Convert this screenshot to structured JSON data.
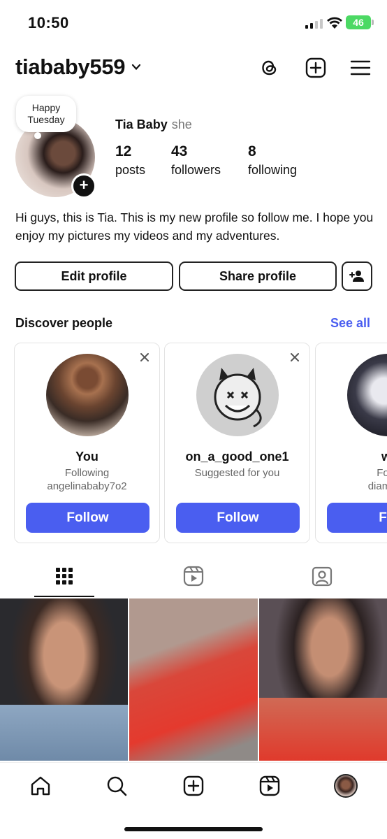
{
  "status_bar": {
    "time": "10:50",
    "battery": "46"
  },
  "header": {
    "username": "tiababy559"
  },
  "profile": {
    "note": "Happy Tuesday",
    "display_name": "Tia Baby",
    "pronouns": "she",
    "stats": [
      {
        "value": "12",
        "label": "posts"
      },
      {
        "value": "43",
        "label": "followers"
      },
      {
        "value": "8",
        "label": "following"
      }
    ],
    "bio": "Hi guys, this is Tia. This is my new profile so follow me. I hope you enjoy my pictures my videos and my adventures."
  },
  "actions": {
    "edit_label": "Edit profile",
    "share_label": "Share profile"
  },
  "discover": {
    "title": "Discover people",
    "see_all": "See all",
    "cards": [
      {
        "name": "You",
        "line1": "Following",
        "line2": "angelinababy7o2",
        "follow_label": "Follow"
      },
      {
        "name": "on_a_good_one1",
        "line1": "Suggested for you",
        "line2": "",
        "follow_label": "Follow"
      },
      {
        "name": "wi",
        "line1": "Follo",
        "line2": "diamond",
        "follow_label": "Fol"
      }
    ]
  },
  "tabs": [
    "grid-icon",
    "reels-icon",
    "tagged-icon"
  ],
  "bottom_nav": [
    "home-icon",
    "search-icon",
    "create-icon",
    "reels-icon",
    "profile-avatar"
  ],
  "colors": {
    "accent": "#4a5ef0",
    "battery": "#4cd964"
  }
}
